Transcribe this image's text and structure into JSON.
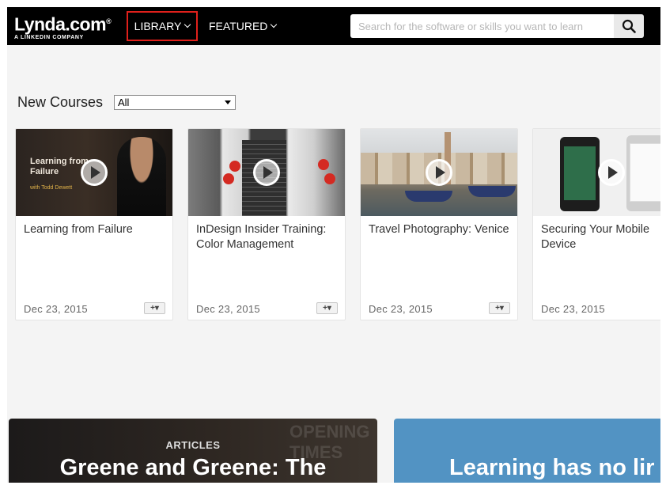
{
  "header": {
    "logo_main": "Lynda.com",
    "logo_reg": "®",
    "logo_sub": "A LINKEDIN COMPANY",
    "nav": [
      {
        "label": "LIBRARY"
      },
      {
        "label": "FEATURED"
      }
    ],
    "search_placeholder": "Search for the software or skills you want to learn"
  },
  "new_courses": {
    "title": "New Courses",
    "filter_value": "All",
    "cards": [
      {
        "title": "Learning from Failure",
        "date": "Dec 23, 2015",
        "thumb_text": "Learning from Failure",
        "thumb_sub": "with Todd Dewett"
      },
      {
        "title": "InDesign Insider Training: Color Management",
        "date": "Dec 23, 2015"
      },
      {
        "title": "Travel Photography: Venice",
        "date": "Dec 23, 2015"
      },
      {
        "title": "Securing Your Mobile Device",
        "date": "Dec 23, 2015"
      }
    ],
    "add_label": "+▾"
  },
  "banners": {
    "left_kicker": "ARTICLES",
    "left_title": "Greene and Greene: The",
    "left_sign": "OPENING TIMES",
    "right_title": "Learning has no lir"
  },
  "colors": {
    "header_bg": "#000000",
    "highlight": "#e0201b",
    "right_banner": "#5293c3"
  }
}
